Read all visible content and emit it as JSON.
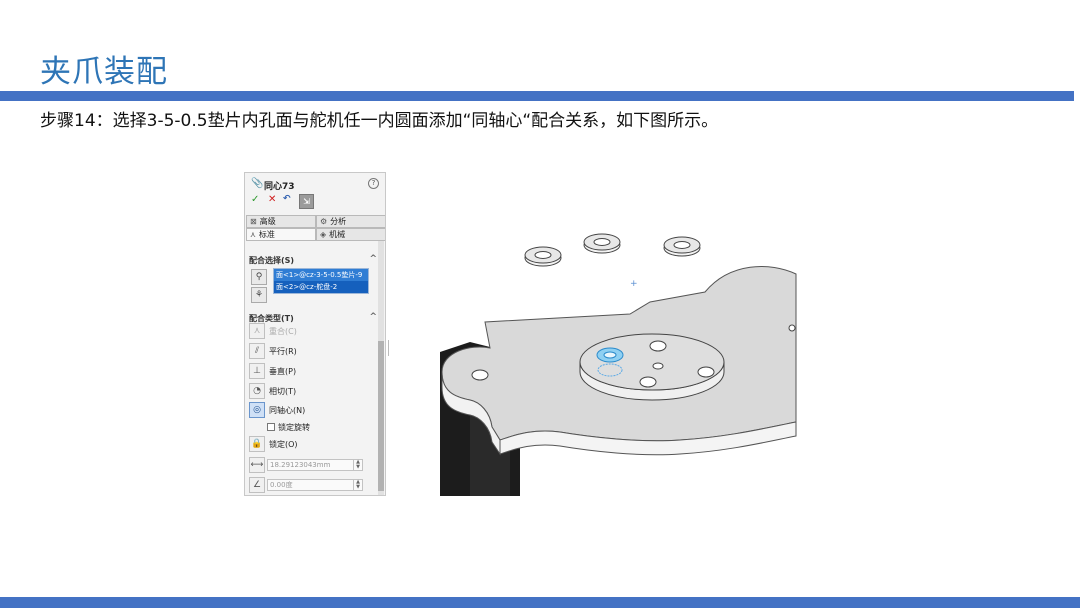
{
  "slide": {
    "title": "夹爪装配",
    "step": "步骤14：选择3-5-0.5垫片内孔面与舵机任一内圆面添加“同轴心“配合关系，如下图所示。"
  },
  "panel": {
    "title": "同心73",
    "help": "?",
    "actions": {
      "ok": "✓",
      "cancel": "✕",
      "undo": "↶",
      "pin": "⇲"
    },
    "tabs": [
      {
        "label": "高级",
        "icon": "advanced-icon"
      },
      {
        "label": "分析",
        "icon": "analysis-icon"
      },
      {
        "label": "标准",
        "icon": "standard-icon"
      },
      {
        "label": "机械",
        "icon": "mechanical-icon"
      }
    ],
    "selections_header": "配合选择(S)",
    "selections": [
      "面<1>@cz-3-5-0.5垫片-9",
      "面<2>@cz-舵盘-2"
    ],
    "types_header": "配合类型(T)",
    "mate_types": [
      {
        "label": "重合(C)",
        "icon": "coincident-icon",
        "glyph": "⋏"
      },
      {
        "label": "平行(R)",
        "icon": "parallel-icon",
        "glyph": "⫽"
      },
      {
        "label": "垂直(P)",
        "icon": "perpendicular-icon",
        "glyph": "⊥"
      },
      {
        "label": "相切(T)",
        "icon": "tangent-icon",
        "glyph": "◔"
      },
      {
        "label": "同轴心(N)",
        "icon": "concentric-icon",
        "glyph": "◎"
      }
    ],
    "lock_rotation": "锁定旋转",
    "lock": {
      "label": "锁定(O)",
      "glyph": "🔒"
    },
    "distance_value": "18.29123043mm",
    "angle_value": "0.00度",
    "collapse": "^"
  },
  "colors": {
    "title": "#2e75b6",
    "bars": "#4472c4",
    "selection": "#2f7dd4"
  }
}
